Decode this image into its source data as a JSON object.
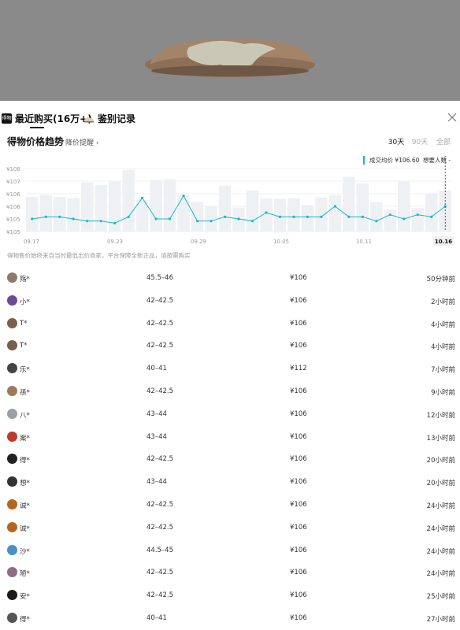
{
  "tabs": {
    "recent_label": "最近购买(16万+)",
    "recent_icon_text": "得物",
    "auth_label": "鉴别记录"
  },
  "trend": {
    "title": "得物价格趋势",
    "alert_label": "降价提醒 ›",
    "ranges": [
      "30天",
      "90天",
      "全部"
    ],
    "active_range": "30天",
    "legend_avg": "成交均价 ¥106.60",
    "legend_want": "想要人数 -",
    "note": "得物售价始终来自当时最低出价商家，平台保障全新正品，请按需购买"
  },
  "colors": {
    "accent": "#19b9c8",
    "bar": "#eef0f3"
  },
  "chart_data": {
    "type": "line",
    "y_ticks": [
      "¥108",
      "¥107",
      "¥106",
      "¥106",
      "¥105",
      "¥105"
    ],
    "x_ticks": [
      "09.17",
      "09.23",
      "09.29",
      "10.05",
      "10.11",
      "10.16"
    ],
    "ylim": [
      105,
      108
    ],
    "avg_price": [
      105.6,
      105.7,
      105.7,
      105.6,
      105.5,
      105.5,
      105.4,
      105.7,
      106.6,
      105.6,
      105.6,
      106.7,
      105.5,
      105.5,
      105.7,
      105.6,
      105.5,
      105.9,
      105.7,
      105.7,
      105.7,
      105.7,
      106.2,
      105.7,
      105.7,
      105.5,
      105.8,
      105.6,
      105.8,
      105.7,
      106.2
    ],
    "want_bars": [
      0.55,
      0.58,
      0.55,
      0.53,
      0.78,
      0.74,
      0.8,
      0.98,
      0.5,
      0.82,
      0.83,
      0.58,
      0.47,
      0.4,
      0.73,
      0.38,
      0.65,
      0.52,
      0.52,
      0.53,
      0.42,
      0.54,
      0.58,
      0.87,
      0.76,
      0.47,
      0.35,
      0.8,
      0.37,
      0.6,
      0.65
    ]
  },
  "records": [
    {
      "name": "殇*",
      "size": "45.5–46",
      "price": "¥106",
      "time": "50分钟前",
      "avatar": "#8d7a6b"
    },
    {
      "name": "小*",
      "size": "42–42.5",
      "price": "¥106",
      "time": "2小时前",
      "avatar": "#6a4c93"
    },
    {
      "name": "T*",
      "size": "42–42.5",
      "price": "¥106",
      "time": "4小时前",
      "avatar": "#7b5e4a"
    },
    {
      "name": "T*",
      "size": "42–42.5",
      "price": "¥106",
      "time": "4小时前",
      "avatar": "#7b5e4a"
    },
    {
      "name": "乐*",
      "size": "40–41",
      "price": "¥112",
      "time": "7小时前",
      "avatar": "#444444"
    },
    {
      "name": "孫*",
      "size": "42–42.5",
      "price": "¥106",
      "time": "9小时前",
      "avatar": "#a0785a"
    },
    {
      "name": "八*",
      "size": "43–44",
      "price": "¥106",
      "time": "12小时前",
      "avatar": "#9aa0a6"
    },
    {
      "name": "案*",
      "size": "43–44",
      "price": "¥106",
      "time": "13小时前",
      "avatar": "#c0392b"
    },
    {
      "name": "得*",
      "size": "42–42.5",
      "price": "¥106",
      "time": "20小时前",
      "avatar": "#222222"
    },
    {
      "name": "想*",
      "size": "43–44",
      "price": "¥106",
      "time": "20小时前",
      "avatar": "#333333"
    },
    {
      "name": "诚*",
      "size": "42–42.5",
      "price": "¥106",
      "time": "24小时前",
      "avatar": "#b5651d"
    },
    {
      "name": "诚*",
      "size": "42–42.5",
      "price": "¥106",
      "time": "24小时前",
      "avatar": "#b5651d"
    },
    {
      "name": "沙*",
      "size": "44.5–45",
      "price": "¥106",
      "time": "24小时前",
      "avatar": "#4a90c2"
    },
    {
      "name": "陋*",
      "size": "42–42.5",
      "price": "¥106",
      "time": "24小时前",
      "avatar": "#8e6c88"
    },
    {
      "name": "安*",
      "size": "42–42.5",
      "price": "¥106",
      "time": "25小时前",
      "avatar": "#1a1a1a"
    },
    {
      "name": "得*",
      "size": "40–41",
      "price": "¥106",
      "time": "27小时前",
      "avatar": "#555555"
    }
  ]
}
